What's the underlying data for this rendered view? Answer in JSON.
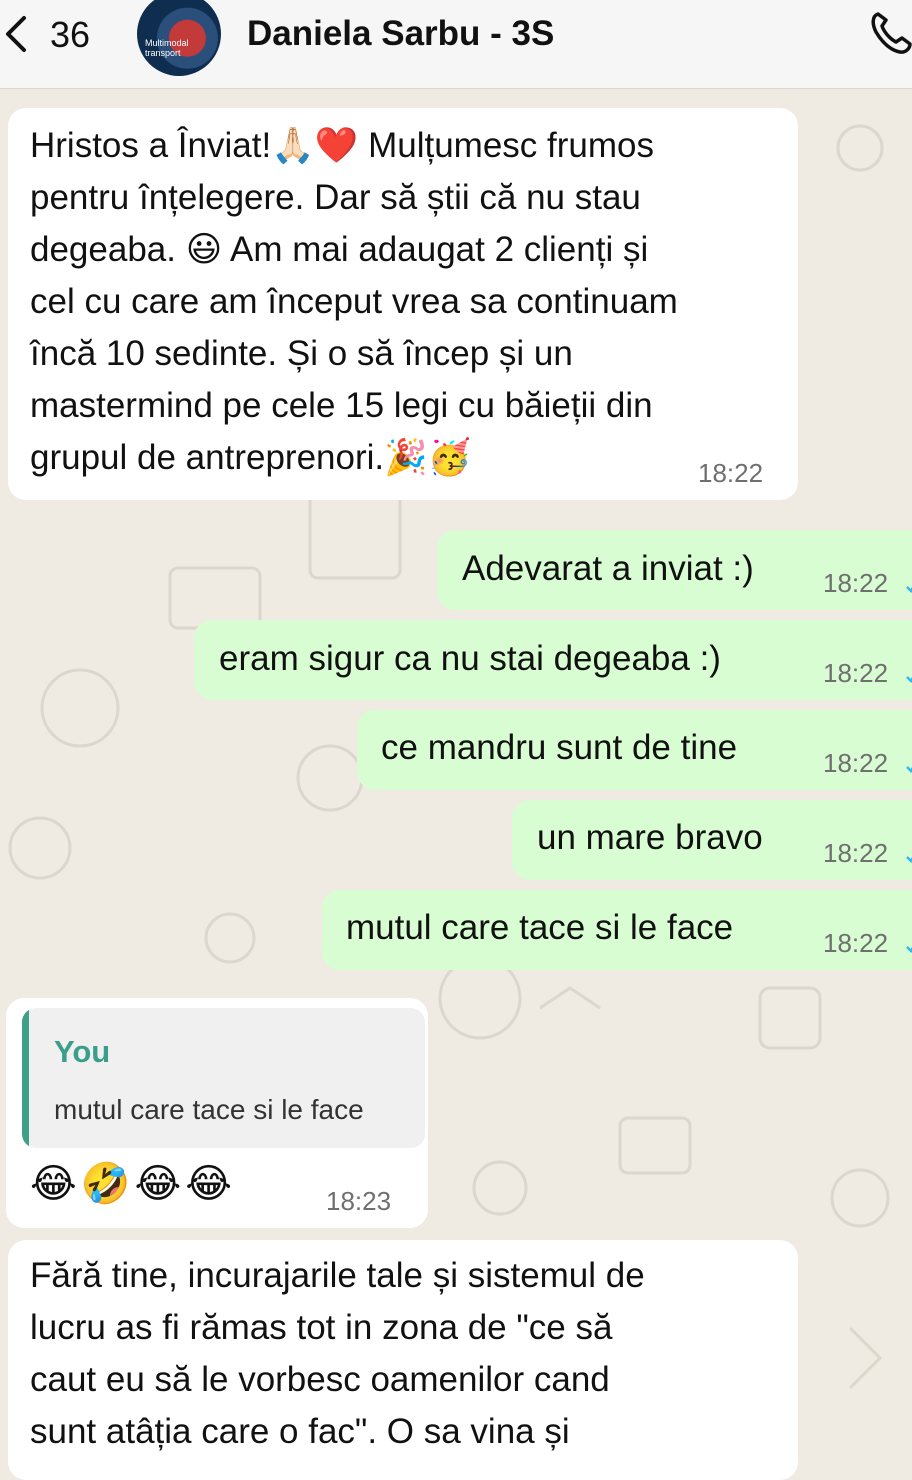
{
  "header": {
    "back_count": "36",
    "contact_name": "Daniela Sarbu - 3S",
    "avatar_text": "Multimodal transport",
    "back_icon": "chevron-left-icon",
    "call_icon": "phone-icon"
  },
  "colors": {
    "incoming_bubble": "#ffffff",
    "outgoing_bubble": "#d9fdd3",
    "chat_background": "#efeae2",
    "quote_accent": "#3fa08a",
    "tick_color": "#34b7f1"
  },
  "messages": [
    {
      "direction": "in",
      "text": "Hristos a Înviat!🙏🏻❤️ Mulțumesc frumos\npentru înțelegere. Dar să știi că nu stau\ndegeaba. 😃 Am mai adaugat 2 clienți și\ncel cu care am început vrea sa continuam\nîncă 10 sedinte. Și o să încep și un\nmastermind pe cele 15 legi cu băieții din\ngrupul de antreprenori.🎉🥳",
      "time": "18:22"
    },
    {
      "direction": "out",
      "text": "Adevarat a inviat :)",
      "time": "18:22",
      "status": "read"
    },
    {
      "direction": "out",
      "text": "eram sigur ca nu stai degeaba :)",
      "time": "18:22",
      "status": "read"
    },
    {
      "direction": "out",
      "text": "ce mandru sunt de tine",
      "time": "18:22",
      "status": "read"
    },
    {
      "direction": "out",
      "text": "un mare bravo",
      "time": "18:22",
      "status": "read"
    },
    {
      "direction": "out",
      "text": "mutul care tace si le face",
      "time": "18:22",
      "status": "read"
    },
    {
      "direction": "in",
      "quote": {
        "author": "You",
        "text": "mutul care tace si le face"
      },
      "text": "😂🤣😂😂",
      "time": "18:23"
    },
    {
      "direction": "in",
      "text": "Fără tine, incurajarile tale și sistemul de\nlucru as fi rămas tot in zona de \"ce să\ncaut eu să le vorbesc oamenilor cand\nsunt atâția care o fac\". O sa vina și",
      "time": ""
    }
  ]
}
